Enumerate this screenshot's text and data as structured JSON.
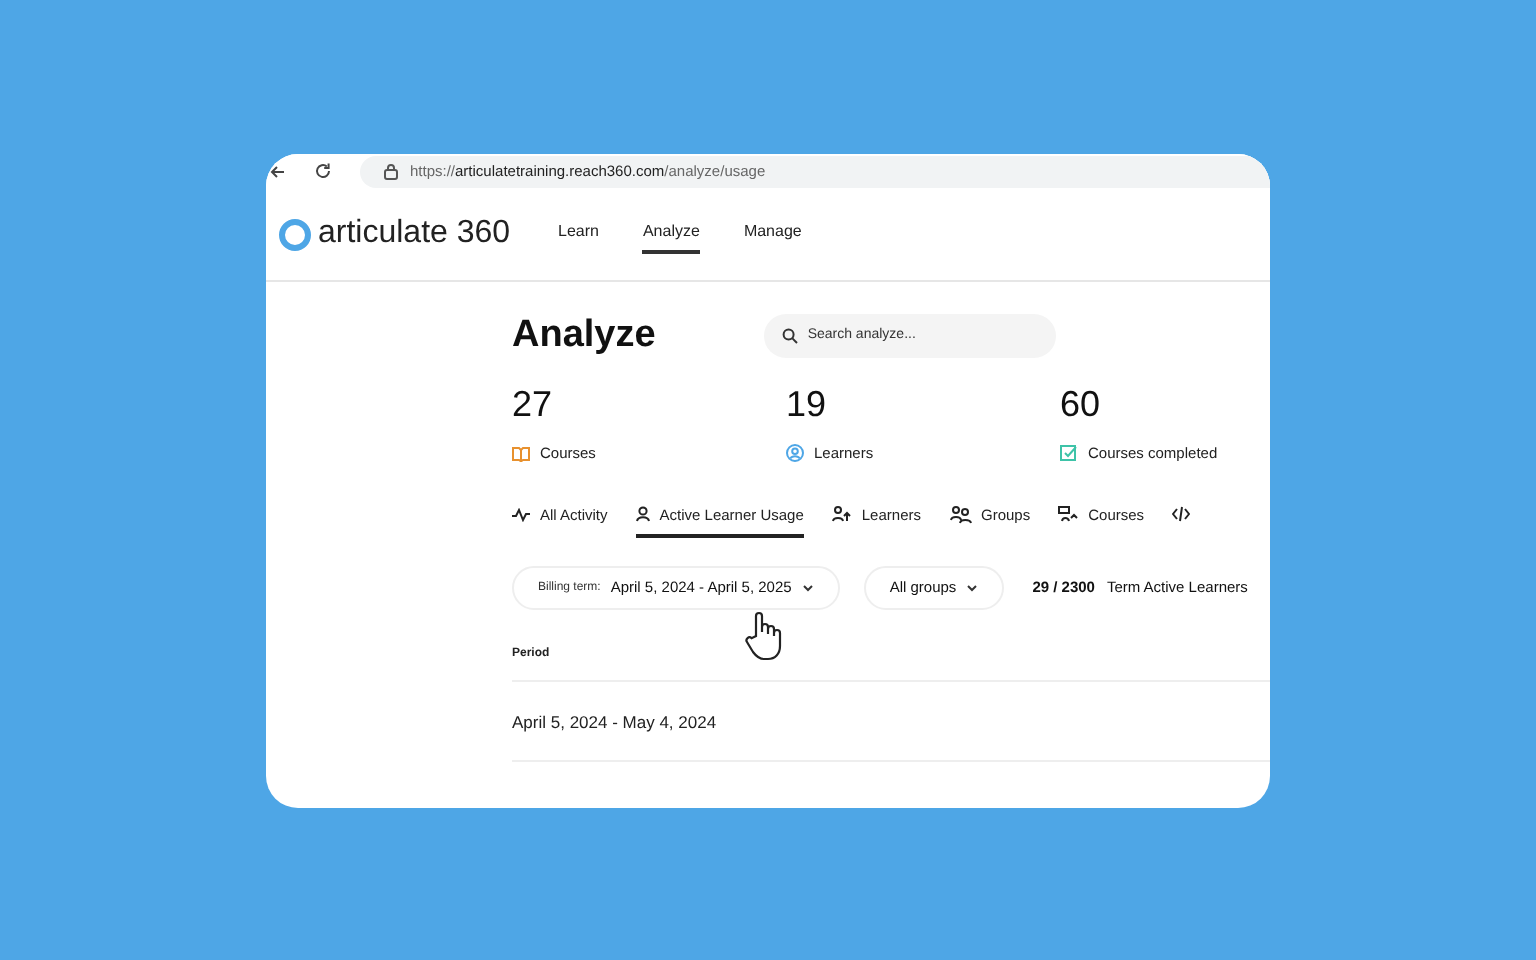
{
  "browser": {
    "url": {
      "scheme": "https://",
      "host": "articulatetraining.reach360.com",
      "path": "/analyze/usage"
    }
  },
  "app": {
    "logo": "articulate 360",
    "nav": [
      {
        "label": "Learn",
        "selected": false
      },
      {
        "label": "Analyze",
        "selected": true
      },
      {
        "label": "Manage",
        "selected": false
      }
    ]
  },
  "page": {
    "title": "Analyze",
    "search": {
      "placeholder": "Search analyze..."
    }
  },
  "stats": [
    {
      "value": "27",
      "label": "Courses",
      "kind": "book"
    },
    {
      "value": "19",
      "label": "Learners",
      "kind": "person"
    },
    {
      "value": "60",
      "label": "Courses completed",
      "kind": "check"
    }
  ],
  "tabs": [
    {
      "label": "All Activity",
      "kind": "pulse",
      "selected": false
    },
    {
      "label": "Active Learner Usage",
      "kind": "person",
      "selected": true
    },
    {
      "label": "Learners",
      "kind": "people",
      "selected": false
    },
    {
      "label": "Groups",
      "kind": "group",
      "selected": false
    },
    {
      "label": "Courses",
      "kind": "courses",
      "selected": false
    },
    {
      "kind": "code",
      "selected": false
    }
  ],
  "filters": {
    "billing": {
      "label": "Billing term:",
      "value": "April 5, 2024 - April 5, 2025"
    },
    "groups": "All groups",
    "count": "29 / 2300",
    "count_label": "Term Active Learners"
  },
  "table": {
    "columns": [
      "Period"
    ],
    "rows": [
      [
        "April 5, 2024 - May 4, 2024"
      ]
    ]
  }
}
